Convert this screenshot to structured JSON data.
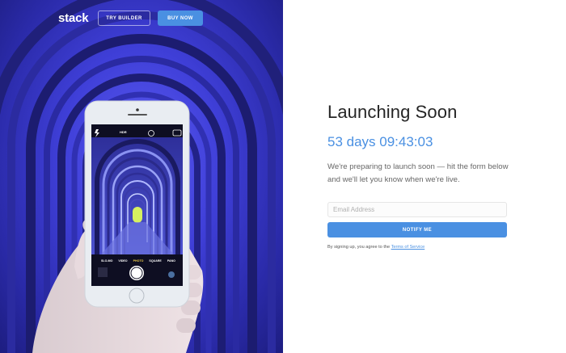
{
  "header": {
    "brand": "stack",
    "try_builder_label": "TRY BUILDER",
    "buy_now_label": "BUY NOW"
  },
  "hero": {
    "phone": {
      "top_bar": [
        "HDR"
      ],
      "modes": [
        "SLO-MO",
        "VIDEO",
        "PHOTO",
        "SQUARE",
        "PANO"
      ]
    }
  },
  "main": {
    "title": "Launching Soon",
    "countdown": "53 days 09:43:03",
    "description": "We're preparing to launch soon — hit the form below and we'll let you know when we're live.",
    "email_placeholder": "Email Address",
    "notify_label": "NOTIFY ME",
    "legal_prefix": "By signing up, you agree to the ",
    "legal_link": "Terms of Service"
  },
  "colors": {
    "accent": "#4a90e2",
    "hero_blue": "#3f3fd8"
  }
}
